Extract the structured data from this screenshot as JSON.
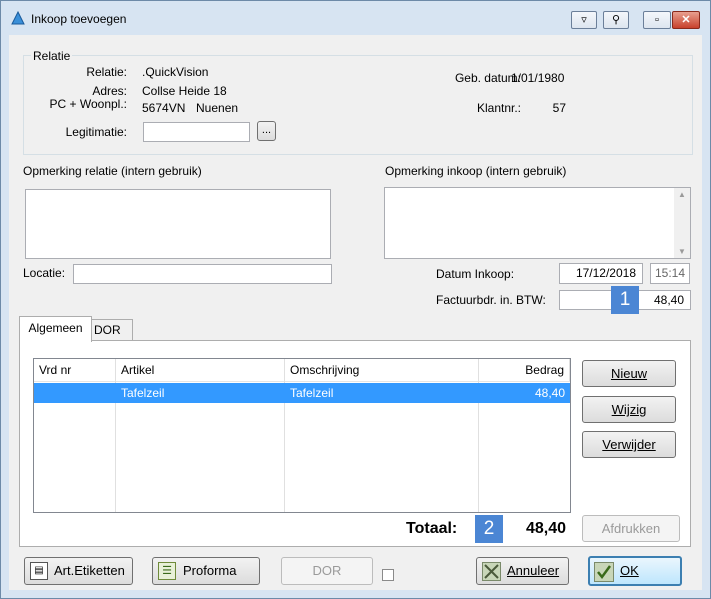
{
  "window": {
    "title": "Inkoop toevoegen"
  },
  "relatie": {
    "group_title": "Relatie",
    "relatie_label": "Relatie:",
    "relatie_value": ".QuickVision",
    "adres_label": "Adres:",
    "adres_value": "Collse Heide 18",
    "pc_label": "PC + Woonpl.:",
    "postcode": "5674VN",
    "woonplaats": "Nuenen",
    "legitimatie_label": "Legitimatie:",
    "legitimatie_value": "",
    "browse_label": "...",
    "gebdatum_label": "Geb. datum:",
    "gebdatum_value": "1/01/1980",
    "klantnr_label": "Klantnr.:",
    "klantnr_value": "57"
  },
  "remarks": {
    "relatie_label": "Opmerking relatie (intern gebruik)",
    "relatie_value": "",
    "inkoop_label": "Opmerking inkoop (intern gebruik)",
    "inkoop_value": ""
  },
  "locatie": {
    "label": "Locatie:",
    "value": ""
  },
  "purchase": {
    "datum_label": "Datum Inkoop:",
    "datum_value": "17/12/2018",
    "tijd_value": "15:14",
    "factuur_label": "Factuurbdr. in. BTW:",
    "factuur_value": "48,40",
    "badge1": "1"
  },
  "tabs": [
    {
      "label": "Algemeen"
    },
    {
      "label": "DOR"
    }
  ],
  "table": {
    "columns": [
      "Vrd nr",
      "Artikel",
      "Omschrijving",
      "Bedrag"
    ],
    "rows": [
      {
        "vrd_nr": "",
        "artikel": "Tafelzeil",
        "omschrijving": "Tafelzeil",
        "bedrag": "48,40"
      }
    ]
  },
  "side_buttons": {
    "nieuw": "Nieuw",
    "wijzig": "Wijzig",
    "verwijder": "Verwijder",
    "afdrukken": "Afdrukken"
  },
  "totaal": {
    "label": "Totaal:",
    "badge2": "2",
    "value": "48,40"
  },
  "bottom": {
    "art_etiketten": "Art.Etiketten",
    "proforma": "Proforma",
    "dor": "DOR",
    "annuleer": "Annuleer",
    "ok": "OK"
  },
  "colors": {
    "selection": "#3399ff",
    "badge": "#4b86d4",
    "window_frame": "#d7e4f2"
  }
}
